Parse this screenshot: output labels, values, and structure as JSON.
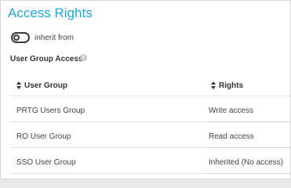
{
  "header": {
    "title": "Access Rights"
  },
  "inherit": {
    "label": "inherit from",
    "enabled": false
  },
  "section": {
    "label": "User Group Access",
    "info_icon": "info-icon"
  },
  "table": {
    "columns": [
      "User Group",
      "Rights"
    ],
    "rows": [
      {
        "group": "PRTG Users Group",
        "rights": "Write access"
      },
      {
        "group": "RO User Group",
        "rights": "Read access"
      },
      {
        "group": "SSO User Group",
        "rights": "Inherited (No access)"
      }
    ]
  },
  "colors": {
    "title": "#1ea7d6",
    "text": "#444444"
  }
}
